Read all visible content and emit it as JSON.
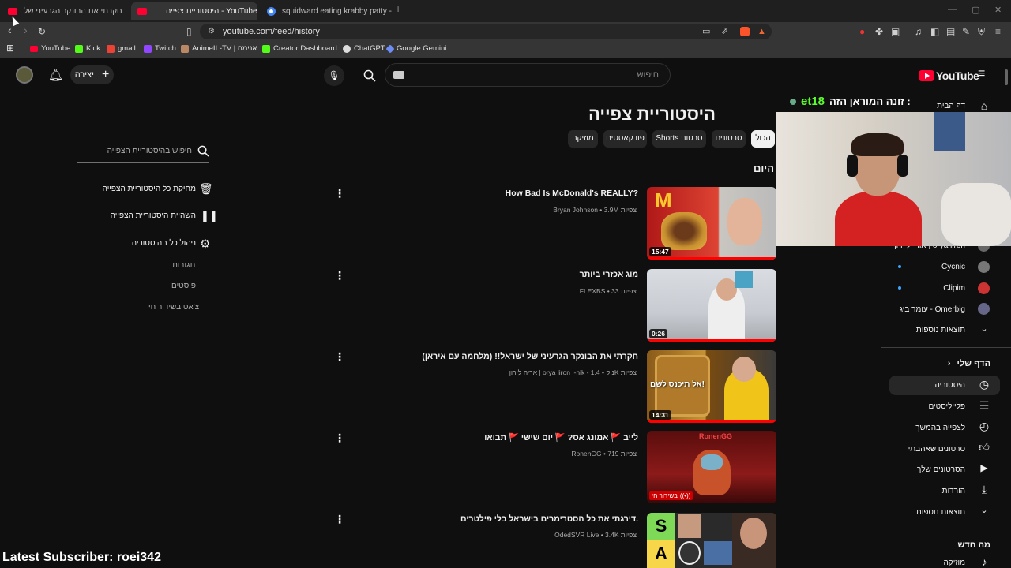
{
  "tabs": [
    {
      "label": "חקרתי את הבונקר הגרעיני של",
      "active": false
    },
    {
      "label": "היסטוריית צפייה - YouTube",
      "active": true
    },
    {
      "label": "squidward eating krabby patty - חיפוש ב",
      "active": false
    }
  ],
  "address": "youtube.com/feed/history",
  "bookmarks": [
    "YouTube",
    "Kick",
    "gmail",
    "Twitch",
    "AnimeIL-TV | אנימה...",
    "Creator Dashboard |...",
    "ChatGPT",
    "Google Gemini"
  ],
  "header": {
    "logo": "YouTube",
    "search_placeholder": "חיפוש",
    "create_label": "יצירה"
  },
  "sidebar": {
    "home": "דף הבית",
    "subs": [
      "אורי ליירון | orya liron",
      "Cycnic",
      "Clipim",
      "עומר ביג - Omerbig"
    ],
    "show_more": "תוצאות נוספות",
    "you_section": "הדף שלי",
    "you_items": [
      "היסטוריה",
      "פלייליסטים",
      "לצפייה בהמשך",
      "סרטונים שאהבתי",
      "הסרטונים שלך",
      "הורדות",
      "תוצאות נוספות"
    ],
    "new_section": "מה חדש",
    "new_first": "מוזיקה"
  },
  "page_title": "היסטוריית צפייה",
  "chips": [
    "הכול",
    "סרטונים",
    "Shorts סרטוני",
    "פודקאסטים",
    "מוזיקה"
  ],
  "section_today": "היום",
  "videos": [
    {
      "title": "How Bad Is McDonald's REALLY?",
      "meta": "Bryan Johnson • 3.9M צפיות",
      "duration": "15:47"
    },
    {
      "title": "מוג אכזרי ביותר",
      "meta": "FLEXBS • 33 צפיות",
      "duration": "0:26"
    },
    {
      "title": "חקרתי את הבונקר הגרעיני של ישראל!! (מלחמה עם איראן)",
      "meta": "אריה לירון | orya liron ו-nik - ניק • 1.4K צפיות",
      "duration": "14:31",
      "thumb_text": "אל תיכנס לשם!"
    },
    {
      "title": "לייב 🚩 אמונג אס? 🚩 יום שישי 🚩 תבואו",
      "meta": "RonenGG • 719 צפיות",
      "duration": "בשידור חי",
      "thumb_text": "RonenGG"
    },
    {
      "title": "דירגתי את כל הסטרימרים בישראל בלי פילטרים.",
      "meta": "OdedSVR Live • 3.4K צפיות",
      "duration": "",
      "tiers": [
        "S",
        "A"
      ]
    }
  ],
  "left_panel": {
    "search_placeholder": "חיפוש בהיסטוריית הצפייה",
    "actions": [
      "מחיקת כל היסטוריית הצפייה",
      "השהיית היסטוריית הצפייה",
      "ניהול כל ההיסטוריה"
    ],
    "links": [
      "תגובות",
      "פוסטים",
      "צ'אט בשידור חי"
    ]
  },
  "overlay": {
    "banner_text": "זונה המוראן הזה :",
    "banner_user": "et18",
    "subscriber_label": "Latest Subscriber: roei342"
  },
  "colors": {
    "yt_red": "#ff0033",
    "banner_green": "#5cff2e"
  }
}
